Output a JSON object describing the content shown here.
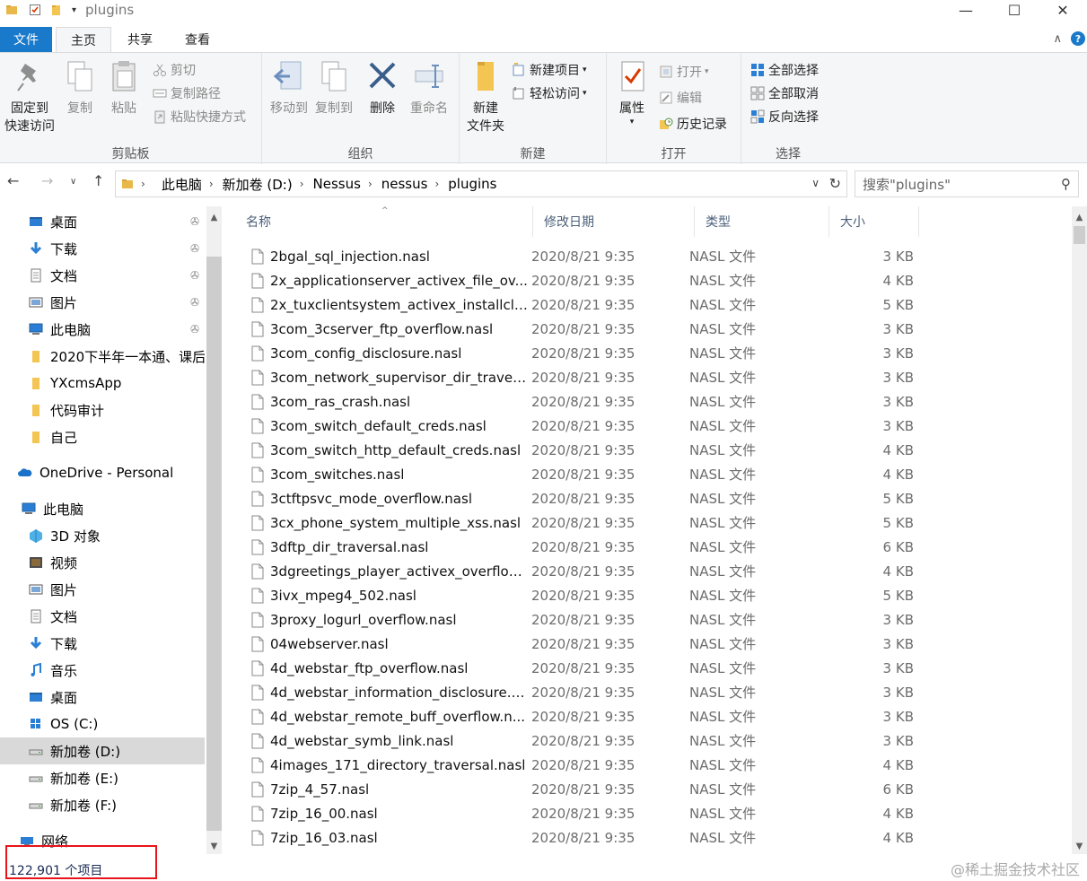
{
  "window": {
    "title": "plugins"
  },
  "ribbon_tabs": {
    "file": "文件",
    "home": "主页",
    "share": "共享",
    "view": "查看"
  },
  "ribbon": {
    "clipboard": {
      "label": "剪贴板",
      "pin": "固定到\n快速访问",
      "pin_line1": "固定到",
      "pin_line2": "快速访问",
      "copy": "复制",
      "paste": "粘贴",
      "cut": "剪切",
      "copy_path": "复制路径",
      "paste_shortcut": "粘贴快捷方式"
    },
    "organize": {
      "label": "组织",
      "move_to": "移动到",
      "copy_to": "复制到",
      "delete": "删除",
      "rename": "重命名"
    },
    "new": {
      "label": "新建",
      "new_folder_line1": "新建",
      "new_folder_line2": "文件夹",
      "new_item": "新建项目",
      "easy_access": "轻松访问"
    },
    "open": {
      "label": "打开",
      "properties": "属性",
      "open": "打开",
      "edit": "编辑",
      "history": "历史记录"
    },
    "select": {
      "label": "选择",
      "select_all": "全部选择",
      "select_none": "全部取消",
      "invert": "反向选择"
    }
  },
  "address": {
    "crumbs": [
      "此电脑",
      "新加卷 (D:)",
      "Nessus",
      "nessus",
      "plugins"
    ]
  },
  "search": {
    "placeholder": "搜索\"plugins\""
  },
  "nav": [
    {
      "label": "桌面",
      "pinned": true
    },
    {
      "label": "下载",
      "pinned": true
    },
    {
      "label": "文档",
      "pinned": true
    },
    {
      "label": "图片",
      "pinned": true
    },
    {
      "label": "此电脑",
      "pinned": true
    },
    {
      "label": "2020下半年一本通、课后"
    },
    {
      "label": "YXcmsApp"
    },
    {
      "label": "代码审计"
    },
    {
      "label": "自己"
    },
    {
      "label": "OneDrive - Personal"
    },
    {
      "label": "此电脑"
    },
    {
      "label": "3D 对象"
    },
    {
      "label": "视频"
    },
    {
      "label": "图片"
    },
    {
      "label": "文档"
    },
    {
      "label": "下载"
    },
    {
      "label": "音乐"
    },
    {
      "label": "桌面"
    },
    {
      "label": "OS (C:)"
    },
    {
      "label": "新加卷 (D:)",
      "selected": true
    },
    {
      "label": "新加卷 (E:)"
    },
    {
      "label": "新加卷 (F:)"
    },
    {
      "label": "网络"
    }
  ],
  "columns": {
    "name": "名称",
    "modified": "修改日期",
    "type": "类型",
    "size": "大小"
  },
  "files": [
    {
      "name": "2bgal_sql_injection.nasl",
      "date": "2020/8/21 9:35",
      "type": "NASL 文件",
      "size": "3 KB"
    },
    {
      "name": "2x_applicationserver_activex_file_ov...",
      "date": "2020/8/21 9:35",
      "type": "NASL 文件",
      "size": "4 KB"
    },
    {
      "name": "2x_tuxclientsystem_activex_installclie...",
      "date": "2020/8/21 9:35",
      "type": "NASL 文件",
      "size": "5 KB"
    },
    {
      "name": "3com_3cserver_ftp_overflow.nasl",
      "date": "2020/8/21 9:35",
      "type": "NASL 文件",
      "size": "3 KB"
    },
    {
      "name": "3com_config_disclosure.nasl",
      "date": "2020/8/21 9:35",
      "type": "NASL 文件",
      "size": "3 KB"
    },
    {
      "name": "3com_network_supervisor_dir_traver...",
      "date": "2020/8/21 9:35",
      "type": "NASL 文件",
      "size": "3 KB"
    },
    {
      "name": "3com_ras_crash.nasl",
      "date": "2020/8/21 9:35",
      "type": "NASL 文件",
      "size": "3 KB"
    },
    {
      "name": "3com_switch_default_creds.nasl",
      "date": "2020/8/21 9:35",
      "type": "NASL 文件",
      "size": "3 KB"
    },
    {
      "name": "3com_switch_http_default_creds.nasl",
      "date": "2020/8/21 9:35",
      "type": "NASL 文件",
      "size": "4 KB"
    },
    {
      "name": "3com_switches.nasl",
      "date": "2020/8/21 9:35",
      "type": "NASL 文件",
      "size": "4 KB"
    },
    {
      "name": "3ctftpsvc_mode_overflow.nasl",
      "date": "2020/8/21 9:35",
      "type": "NASL 文件",
      "size": "5 KB"
    },
    {
      "name": "3cx_phone_system_multiple_xss.nasl",
      "date": "2020/8/21 9:35",
      "type": "NASL 文件",
      "size": "5 KB"
    },
    {
      "name": "3dftp_dir_traversal.nasl",
      "date": "2020/8/21 9:35",
      "type": "NASL 文件",
      "size": "6 KB"
    },
    {
      "name": "3dgreetings_player_activex_overflow...",
      "date": "2020/8/21 9:35",
      "type": "NASL 文件",
      "size": "4 KB"
    },
    {
      "name": "3ivx_mpeg4_502.nasl",
      "date": "2020/8/21 9:35",
      "type": "NASL 文件",
      "size": "5 KB"
    },
    {
      "name": "3proxy_logurl_overflow.nasl",
      "date": "2020/8/21 9:35",
      "type": "NASL 文件",
      "size": "3 KB"
    },
    {
      "name": "04webserver.nasl",
      "date": "2020/8/21 9:35",
      "type": "NASL 文件",
      "size": "3 KB"
    },
    {
      "name": "4d_webstar_ftp_overflow.nasl",
      "date": "2020/8/21 9:35",
      "type": "NASL 文件",
      "size": "3 KB"
    },
    {
      "name": "4d_webstar_information_disclosure.n...",
      "date": "2020/8/21 9:35",
      "type": "NASL 文件",
      "size": "3 KB"
    },
    {
      "name": "4d_webstar_remote_buff_overflow.n...",
      "date": "2020/8/21 9:35",
      "type": "NASL 文件",
      "size": "3 KB"
    },
    {
      "name": "4d_webstar_symb_link.nasl",
      "date": "2020/8/21 9:35",
      "type": "NASL 文件",
      "size": "3 KB"
    },
    {
      "name": "4images_171_directory_traversal.nasl",
      "date": "2020/8/21 9:35",
      "type": "NASL 文件",
      "size": "4 KB"
    },
    {
      "name": "7zip_4_57.nasl",
      "date": "2020/8/21 9:35",
      "type": "NASL 文件",
      "size": "6 KB"
    },
    {
      "name": "7zip_16_00.nasl",
      "date": "2020/8/21 9:35",
      "type": "NASL 文件",
      "size": "4 KB"
    },
    {
      "name": "7zip_16_03.nasl",
      "date": "2020/8/21 9:35",
      "type": "NASL 文件",
      "size": "4 KB"
    }
  ],
  "status": {
    "count": "122,901 个项目"
  },
  "watermark": "@稀土掘金技术社区",
  "colors": {
    "accent": "#1979ca",
    "highlight_box": "#e8141a",
    "selected_nav": "#d9d9d9"
  }
}
